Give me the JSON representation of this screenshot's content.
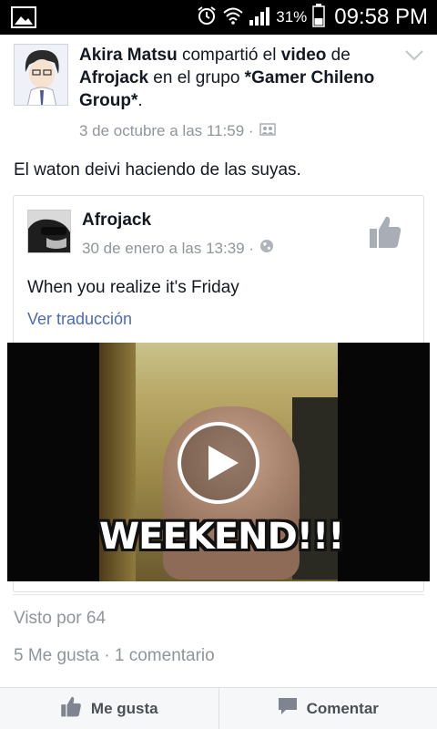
{
  "status_bar": {
    "battery_percent": "31%",
    "time": "09:58 PM"
  },
  "post": {
    "author": "Akira Matsu",
    "verb_shared": " compartió el ",
    "object": "video",
    "prep_of": " de ",
    "source": "Afrojack",
    "in_group": " en el grupo ",
    "group": "*Gamer Chileno Group*",
    "end": ".",
    "timestamp": "3 de octubre a las 11:59 ·",
    "text": "El waton deivi haciendo de las suyas."
  },
  "shared_post": {
    "author": "Afrojack",
    "timestamp": "30 de enero a las 13:39 ·",
    "text": "When you realize it's Friday",
    "translate_link": "Ver traducción",
    "video_caption": "WEEKEND!!!"
  },
  "stats": {
    "seen_by": "Visto por 64",
    "likes_comments": "5 Me gusta · 1 comentario"
  },
  "actions": {
    "like_label": "Me gusta",
    "comment_label": "Comentar"
  },
  "colors": {
    "link_blue": "#4b6cb0",
    "meta_gray": "#90949c",
    "text": "#141823"
  }
}
